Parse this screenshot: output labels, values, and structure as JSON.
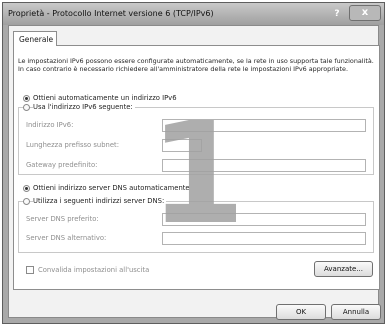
{
  "window": {
    "title": "Proprietà - Protocollo Internet versione 6 (TCP/IPv6)",
    "help_label": "?",
    "close_label": "x"
  },
  "tabs": [
    {
      "label": "Generale",
      "selected": true
    }
  ],
  "description": "Le impostazioni IPv6 possono essere configurate automaticamente, se la rete in uso supporta tale funzionalità. In caso contrario è necessario richiedere all'amministratore della rete le impostazioni IPv6 appropriate.",
  "ip_section": {
    "auto_label": "Ottieni automaticamente un indirizzo IPv6",
    "auto_selected": true,
    "manual_label": "Usa l'indirizzo IPv6 seguente:",
    "fields": [
      {
        "label": "Indirizzo IPv6:",
        "value": ""
      },
      {
        "label": "Lunghezza prefisso subnet:",
        "value": ""
      },
      {
        "label": "Gateway predefinito:",
        "value": ""
      }
    ]
  },
  "dns_section": {
    "auto_label": "Ottieni indirizzo server DNS automaticamente",
    "auto_selected": true,
    "manual_label": "Utilizza i seguenti indirizzi server DNS:",
    "fields": [
      {
        "label": "Server DNS preferito:",
        "value": ""
      },
      {
        "label": "Server DNS alternativo:",
        "value": ""
      }
    ]
  },
  "validate_label": "Convalida impostazioni all'uscita",
  "validate_checked": false,
  "advanced_label": "Avanzate...",
  "ok_label": "OK",
  "cancel_label": "Annulla",
  "overlay_number": "1",
  "colors": {
    "overlay": "#a0a0a0",
    "titlebar": "#b0b0b0",
    "panel": "#ffffff"
  }
}
